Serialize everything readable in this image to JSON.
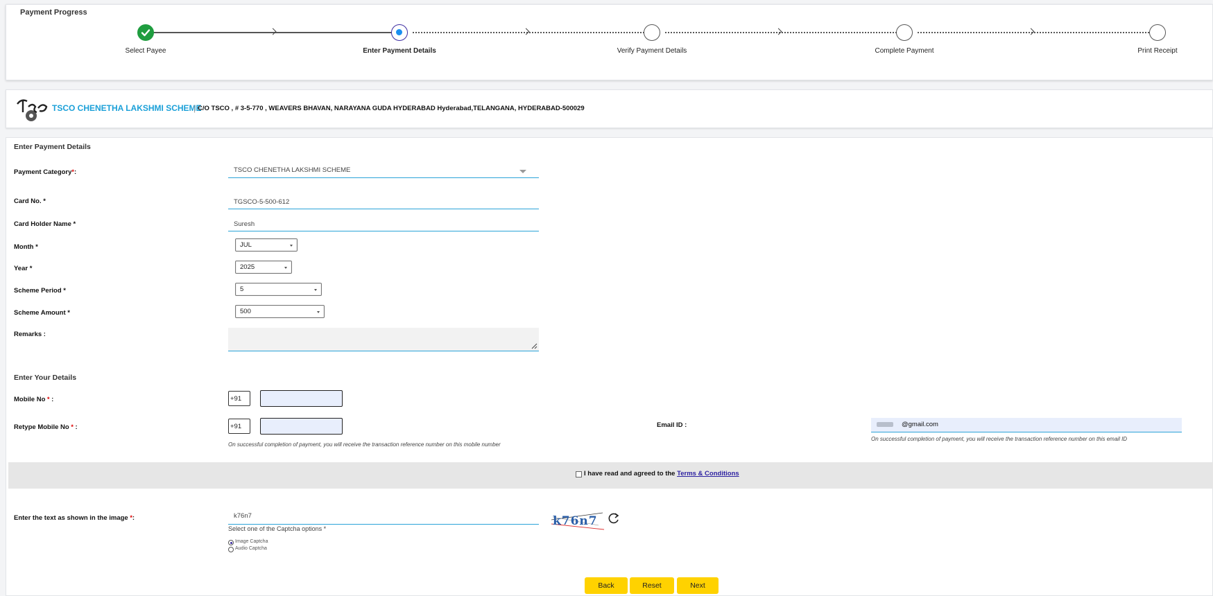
{
  "progress": {
    "title": "Payment Progress",
    "steps": [
      {
        "label": "Select Payee",
        "state": "done"
      },
      {
        "label": "Enter Payment Details",
        "state": "active"
      },
      {
        "label": "Verify Payment Details",
        "state": "pending"
      },
      {
        "label": "Complete Payment",
        "state": "pending"
      },
      {
        "label": "Print Receipt",
        "state": "pending"
      }
    ]
  },
  "payee": {
    "name": "TSCO CHENETHA LAKSHMI SCHEME",
    "separator": "|",
    "address": "C/O TSCO , # 3-5-770 , WEAVERS BHAVAN, NARAYANA GUDA HYDERABAD Hyderabad,TELANGANA, HYDERABAD-500029"
  },
  "payment_details": {
    "section_title": "Enter Payment Details",
    "category_label": "Payment Category",
    "category_value": "TSCO CHENETHA LAKSHMI SCHEME",
    "card_no_label": "Card No. *",
    "card_no_value": "TGSCO-5-500-612",
    "holder_label": "Card Holder Name *",
    "holder_value": "Suresh",
    "month_label": "Month *",
    "month_value": "JUL",
    "year_label": "Year *",
    "year_value": "2025",
    "period_label": "Scheme Period *",
    "period_value": "5",
    "amount_label": "Scheme Amount *",
    "amount_value": "500",
    "remarks_label": "Remarks :"
  },
  "your_details": {
    "section_title": "Enter Your Details",
    "mobile_label": "Mobile No",
    "retype_label": "Retype Mobile No",
    "country_code": "+91",
    "mobile_hint": "On successful completion of payment, you will receive the transaction reference number on this mobile number",
    "email_label": "Email ID :",
    "email_value": "@gmail.com",
    "email_hint": "On successful completion of payment, you will receive the transaction reference number on this email ID"
  },
  "terms": {
    "text": "I have read and agreed to the",
    "link": "Terms & Conditions",
    "checked": false
  },
  "captcha": {
    "label": "Enter the text as shown in the image",
    "value": "k76n7",
    "image_text": "k76n7",
    "options_label": "Select one of the Captcha options *",
    "options": [
      {
        "label": "Image Captcha",
        "selected": true
      },
      {
        "label": "Audio Captcha",
        "selected": false
      }
    ]
  },
  "buttons": {
    "back": "Back",
    "reset": "Reset",
    "next": "Next"
  },
  "colors": {
    "accent": "#2aa3d8",
    "brand": "#1ba0d8",
    "button": "#ffd200",
    "done": "#1f9d3f",
    "required": "#dd0000"
  }
}
